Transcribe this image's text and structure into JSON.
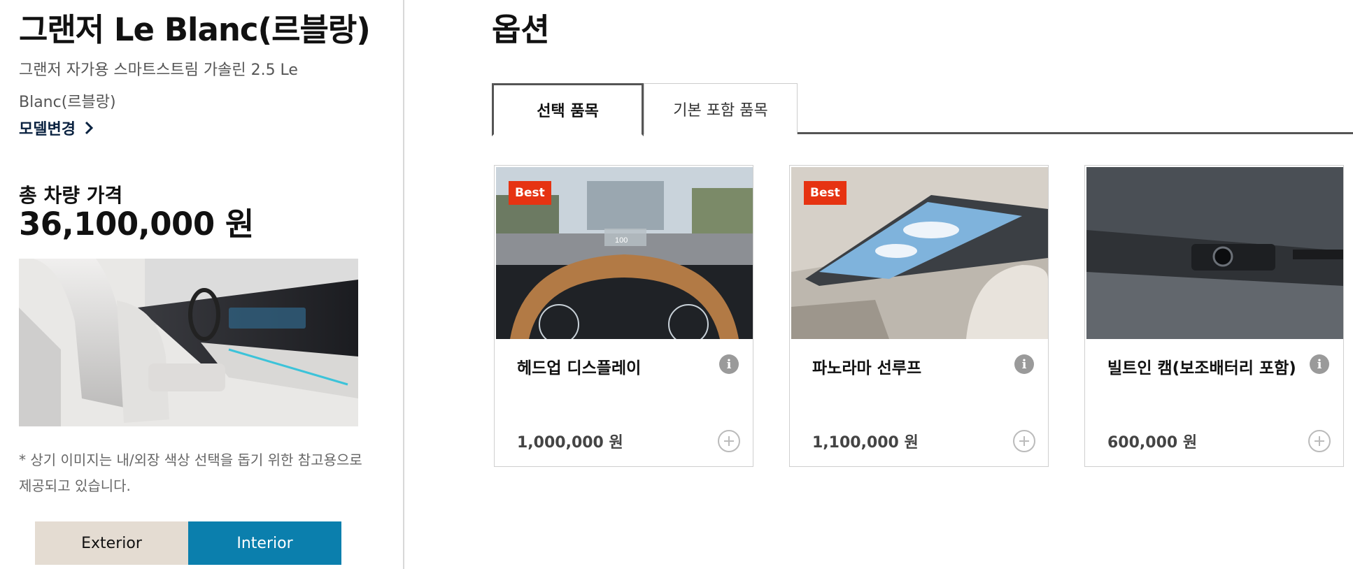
{
  "sidebar": {
    "model_title": "그랜저 Le Blanc(르블랑)",
    "model_subtitle": "그랜저 자가용 스마트스트림 가솔린 2.5 Le Blanc(르블랑)",
    "model_change_label": "모델변경",
    "price_label": "총 차량 가격",
    "price_value": "36,100,000 원",
    "disclaimer": "* 상기 이미지는 내/외장 색상 선택을 돕기 위한 참고용으로 제공되고 있습니다.",
    "view_buttons": {
      "exterior": "Exterior",
      "interior": "Interior",
      "selected": "Interior"
    }
  },
  "options": {
    "title": "옵션",
    "tabs": [
      {
        "label": "선택 품목",
        "active": true
      },
      {
        "label": "기본 포함 품목",
        "active": false
      }
    ],
    "cards": [
      {
        "badge": "Best",
        "name": "헤드업 디스플레이",
        "price": "1,000,000 원"
      },
      {
        "badge": "Best",
        "name": "파노라마 선루프",
        "price": "1,100,000 원"
      },
      {
        "badge": "",
        "name": "빌트인 캠(보조배터리 포함)",
        "price": "600,000 원"
      }
    ]
  },
  "colors": {
    "accent_blue": "#0b7fad",
    "badge_red": "#e63312",
    "exterior_beige": "#e4dcd2",
    "link_navy": "#0a2240"
  },
  "icons": {
    "model_change": "chevron-right-icon",
    "info": "info-icon",
    "add": "plus-circle-icon"
  }
}
